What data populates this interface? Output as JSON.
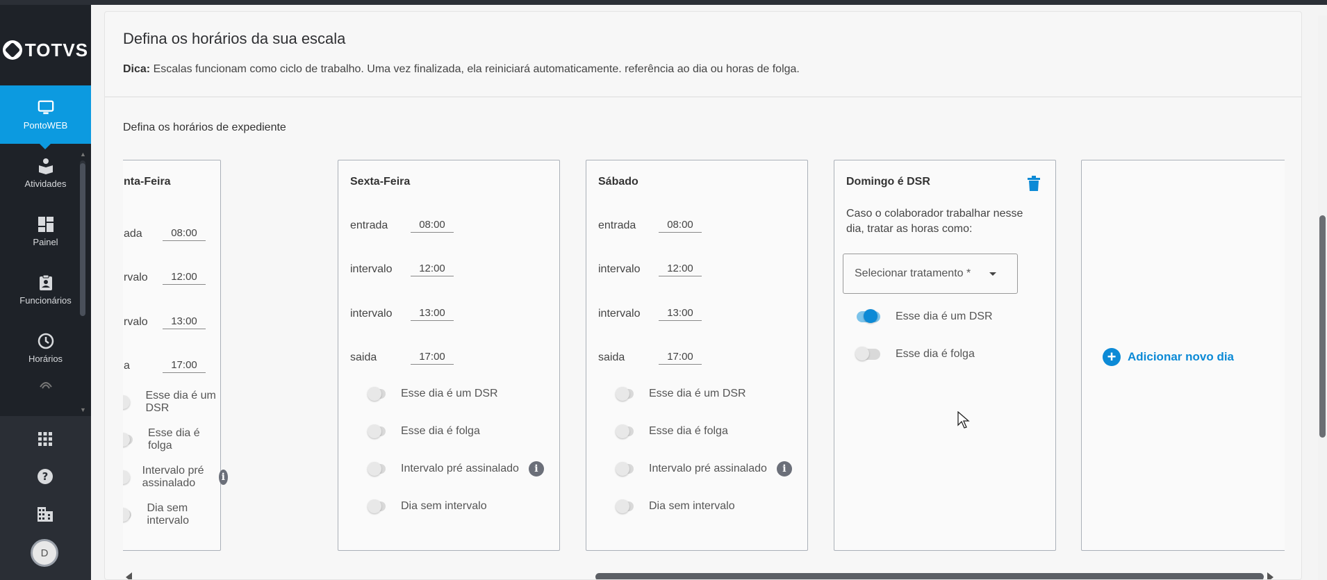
{
  "app": {
    "logo_text": "TOTVS"
  },
  "sidebar": {
    "items": [
      {
        "label": "PontoWEB",
        "icon": "monitor-icon",
        "active": true
      },
      {
        "label": "Atividades",
        "icon": "activities-icon",
        "active": false
      },
      {
        "label": "Painel",
        "icon": "dashboard-icon",
        "active": false
      },
      {
        "label": "Funcionários",
        "icon": "employee-badge-icon",
        "active": false
      },
      {
        "label": "Horários",
        "icon": "clock-icon",
        "active": false
      }
    ],
    "tools": [
      "apps-grid-icon",
      "help-icon",
      "building-icon"
    ],
    "avatar_initial": "D"
  },
  "header": {
    "title": "Defina os horários da sua escala",
    "tip_label": "Dica:",
    "tip_text": "Escalas funcionam como ciclo de trabalho. Uma vez finalizada, ela reiniciará automaticamente. referência ao dia ou horas de folga."
  },
  "section_title": "Defina os horários de expediente",
  "days": [
    {
      "title": "nta-Feira",
      "rows": [
        {
          "label": "ada",
          "value": "08:00"
        },
        {
          "label": "rvalo",
          "value": "12:00"
        },
        {
          "label": "rvalo",
          "value": "13:00"
        },
        {
          "label": "a",
          "value": "17:00"
        }
      ]
    },
    {
      "title": "Sexta-Feira",
      "rows": [
        {
          "label": "entrada",
          "value": "08:00"
        },
        {
          "label": "intervalo",
          "value": "12:00"
        },
        {
          "label": "intervalo",
          "value": "13:00"
        },
        {
          "label": "saida",
          "value": "17:00"
        }
      ]
    },
    {
      "title": "Sábado",
      "rows": [
        {
          "label": "entrada",
          "value": "08:00"
        },
        {
          "label": "intervalo",
          "value": "12:00"
        },
        {
          "label": "intervalo",
          "value": "13:00"
        },
        {
          "label": "saida",
          "value": "17:00"
        }
      ]
    }
  ],
  "toggles": {
    "dsr": "Esse dia é um DSR",
    "folga": "Esse dia é folga",
    "pre_assinalado": "Intervalo pré assinalado",
    "sem_intervalo": "Dia sem intervalo"
  },
  "dsr_card": {
    "title": "Domingo é DSR",
    "description": "Caso o colaborador trabalhar nesse dia, tratar as horas como:",
    "select_placeholder": "Selecionar tratamento *",
    "toggle_dsr": "Esse dia é um DSR",
    "toggle_dsr_on": true,
    "toggle_folga": "Esse dia é folga",
    "toggle_folga_on": false
  },
  "add_day_label": "Adicionar novo dia",
  "colors": {
    "accent": "#0c9ae0",
    "sidebar": "#1e2228"
  }
}
